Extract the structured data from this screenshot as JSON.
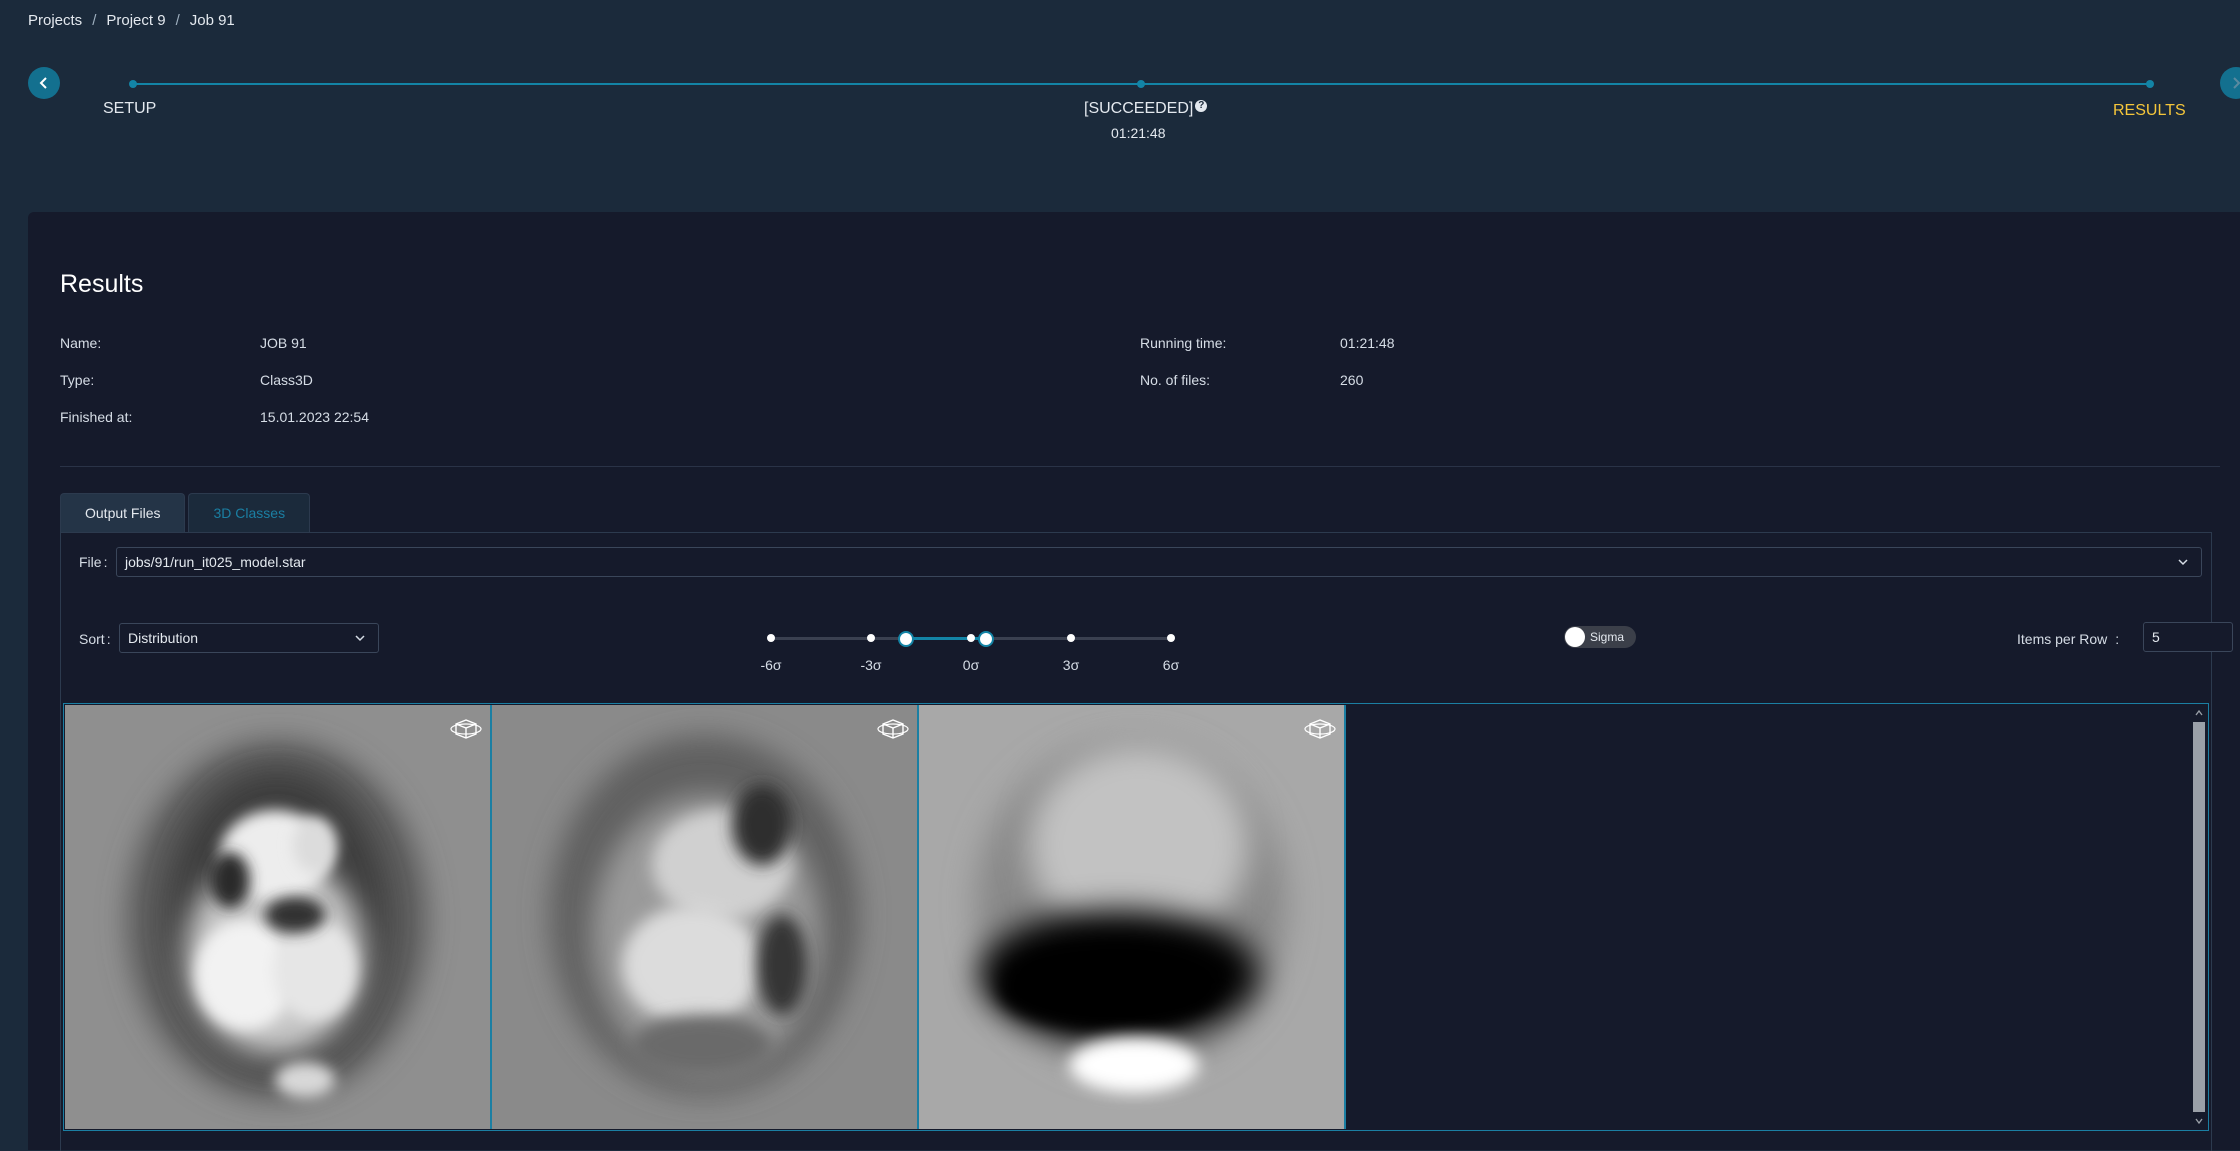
{
  "breadcrumb": {
    "items": [
      "Projects",
      "Project 9",
      "Job 91"
    ],
    "separator": "/"
  },
  "timeline": {
    "steps": {
      "setup": "SETUP",
      "status": "[SUCCEEDED]",
      "status_time": "01:21:48",
      "results": "RESULTS"
    },
    "help": "?"
  },
  "results": {
    "title": "Results",
    "left": [
      {
        "label": "Name:",
        "value": "JOB 91"
      },
      {
        "label": "Type:",
        "value": "Class3D"
      },
      {
        "label": "Finished at:",
        "value": "15.01.2023 22:54"
      }
    ],
    "right": [
      {
        "label": "Running time:",
        "value": "01:21:48"
      },
      {
        "label": "No. of files:",
        "value": "260"
      }
    ]
  },
  "tabs": [
    {
      "label": "Output Files"
    },
    {
      "label": "3D Classes"
    }
  ],
  "controls": {
    "file_label": "File",
    "file_value": "jobs/91/run_it025_model.star",
    "sort_label": "Sort",
    "sort_value": "Distribution",
    "colon": ":",
    "sigma_ticks": [
      "-6σ",
      "-3σ",
      "0σ",
      "3σ",
      "6σ"
    ],
    "sigma_range": [
      -1.5,
      1.5
    ],
    "sigma_toggle_label": "Sigma",
    "sigma_toggle_on": false,
    "items_per_row_label": "Items per Row",
    "items_per_row_value": "5"
  },
  "gallery": {
    "items": [
      {
        "icon": "3d-view-icon"
      },
      {
        "icon": "3d-view-icon"
      },
      {
        "icon": "3d-view-icon"
      }
    ]
  },
  "colors": {
    "accent": "#1384a6",
    "results_highlight": "#f5c63b",
    "panel": "#151a2b",
    "page": "#1b2a3b"
  }
}
